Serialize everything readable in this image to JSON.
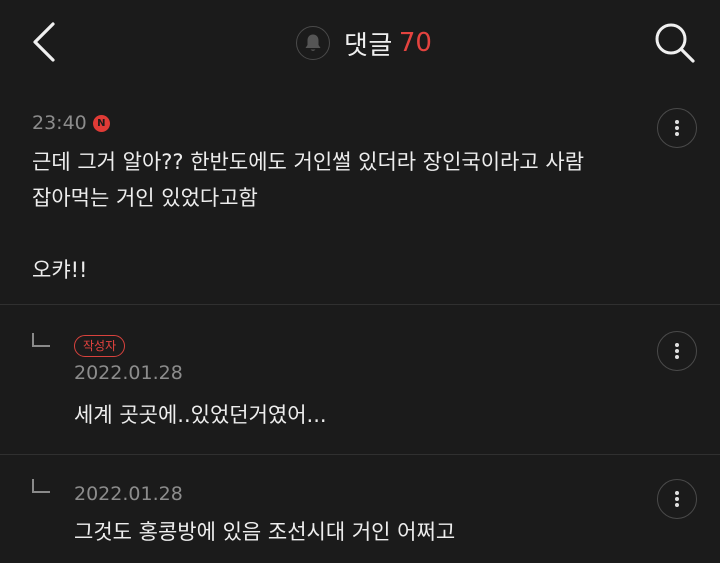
{
  "header": {
    "title": "댓글",
    "count": "70",
    "back_icon": "chevron-left-icon",
    "bell_icon": "bell-icon",
    "search_icon": "search-icon"
  },
  "comments": [
    {
      "time": "23:40",
      "new_badge": "N",
      "text": "근데 그거 알아?? 한반도에도 거인썰 있더라 장인국이라고 사람\n잡아먹는 거인 있었다고함\n\n오캬!!"
    },
    {
      "author_badge": "작성자",
      "time": "2022.01.28",
      "text": "세계 곳곳에..있었던거였어..."
    },
    {
      "time": "2022.01.28",
      "text": "그것도 홍콩방에 있음 조선시대 거인 어쩌고"
    }
  ],
  "colors": {
    "background": "#1b1b1b",
    "accent": "#e4433f",
    "meta_text": "#8c8c8c",
    "body_text": "#ededed"
  }
}
